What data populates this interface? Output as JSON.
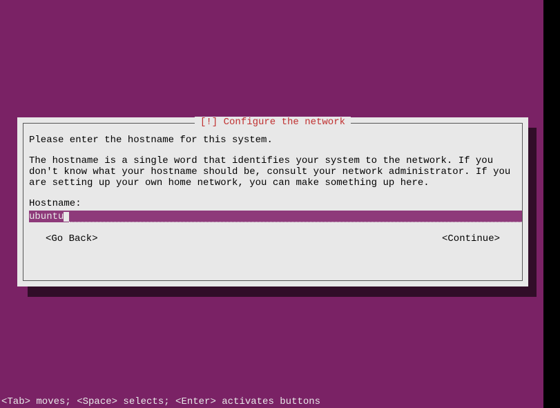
{
  "dialog": {
    "title": "[!] Configure the network",
    "intro": "Please enter the hostname for this system.",
    "description": "The hostname is a single word that identifies your system to the network. If you don't know what your hostname should be, consult your network administrator. If you are setting up your own home network, you can make something up here.",
    "field_label": "Hostname:",
    "input_value": "ubuntu",
    "go_back": "<Go Back>",
    "continue": "<Continue>"
  },
  "help_text": "<Tab> moves; <Space> selects; <Enter> activates buttons"
}
